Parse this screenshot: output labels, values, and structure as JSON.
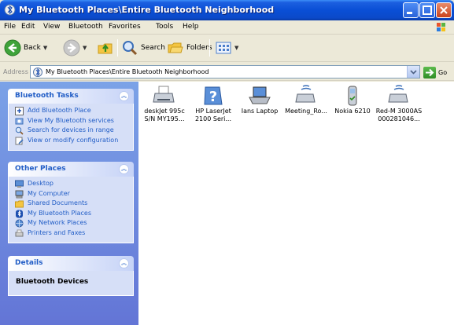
{
  "window": {
    "title": "My Bluetooth Places\\Entire Bluetooth Neighborhood"
  },
  "menu": [
    "File",
    "Edit",
    "View",
    "Bluetooth",
    "Favorites",
    "Tools",
    "Help"
  ],
  "toolbar": {
    "back": "Back",
    "search": "Search",
    "folders": "Folders"
  },
  "address": {
    "label": "Address",
    "path": "My Bluetooth Places\\Entire Bluetooth Neighborhood",
    "go": "Go"
  },
  "panels": {
    "bluetooth_tasks": {
      "title": "Bluetooth Tasks",
      "items": [
        {
          "label": "Add Bluetooth Place",
          "icon": "add-place-icon"
        },
        {
          "label": "View My Bluetooth services",
          "icon": "view-services-icon"
        },
        {
          "label": "Search for devices in range",
          "icon": "search-devices-icon"
        },
        {
          "label": "View or modify configuration",
          "icon": "configuration-icon"
        }
      ]
    },
    "other_places": {
      "title": "Other Places",
      "items": [
        {
          "label": "Desktop",
          "icon": "desktop-icon"
        },
        {
          "label": "My Computer",
          "icon": "my-computer-icon"
        },
        {
          "label": "Shared Documents",
          "icon": "shared-documents-icon"
        },
        {
          "label": "My Bluetooth Places",
          "icon": "bluetooth-places-icon"
        },
        {
          "label": "My Network Places",
          "icon": "network-places-icon"
        },
        {
          "label": "Printers and Faxes",
          "icon": "printers-faxes-icon"
        }
      ]
    },
    "details": {
      "title": "Details",
      "text": "Bluetooth Devices"
    }
  },
  "devices": [
    {
      "label": "deskJet 995c\nS/N MY195...",
      "icon": "inkjet-printer-icon"
    },
    {
      "label": "HP LaserJet\n2100 Seri...",
      "icon": "unknown-device-icon"
    },
    {
      "label": "Ians Laptop",
      "icon": "laptop-icon"
    },
    {
      "label": "Meeting_Ro...",
      "icon": "network-access-icon"
    },
    {
      "label": "Nokia 6210",
      "icon": "mobile-phone-icon"
    },
    {
      "label": "Red-M 3000AS\n000281046...",
      "icon": "network-access-point-icon"
    }
  ],
  "colors": {
    "titlebar": "#0a4fd6",
    "taskpane": "#7ba2e7",
    "link": "#215dc6"
  }
}
